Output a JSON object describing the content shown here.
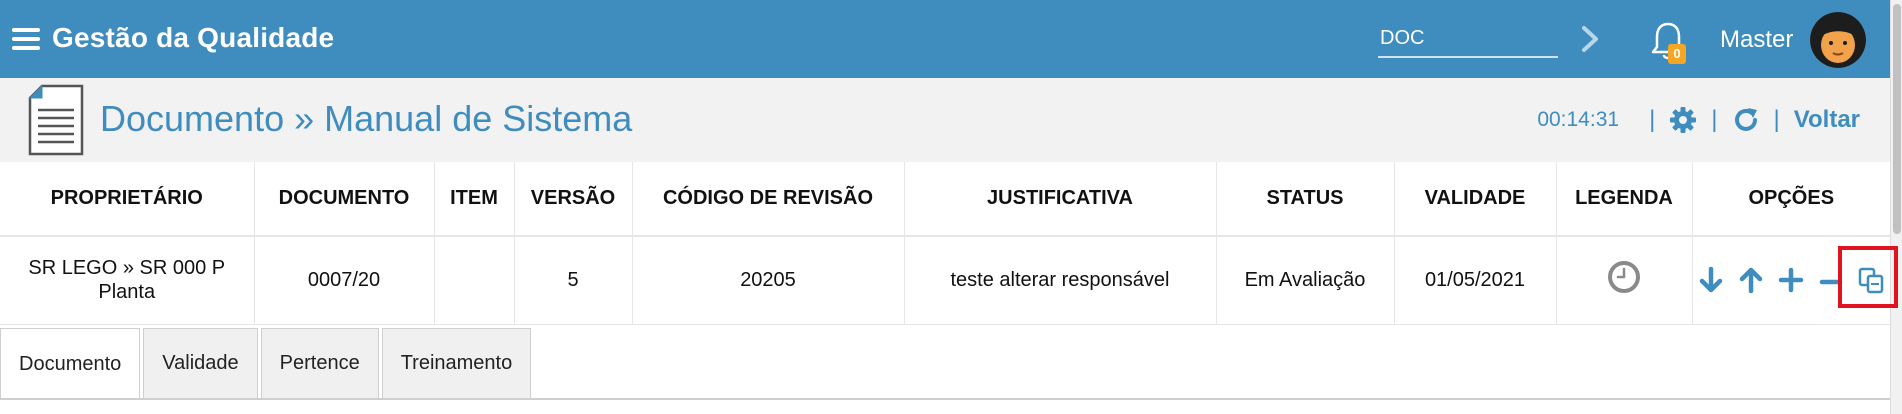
{
  "topbar": {
    "app_title": "Gestão da Qualidade",
    "search": {
      "value": "DOC",
      "placeholder": ""
    },
    "notifications_count": "0",
    "user_name": "Master",
    "bg_color": "#3f8dbf"
  },
  "header": {
    "title": "Documento » Manual de Sistema",
    "timer": "00:14:31",
    "back_label": "Voltar",
    "accent_color": "#3f8dbf"
  },
  "table": {
    "columns": [
      "PROPRIETÁRIO",
      "DOCUMENTO",
      "ITEM",
      "VERSÃO",
      "CÓDIGO DE REVISÃO",
      "JUSTIFICATIVA",
      "STATUS",
      "VALIDADE",
      "LEGENDA",
      "OPÇÕES"
    ],
    "row": {
      "proprietario": "SR LEGO » SR 000 P Planta",
      "documento": "0007/20",
      "item": "",
      "versao": "5",
      "codigo_revisao": "20205",
      "justificativa": "teste alterar responsável",
      "status": "Em Avaliação",
      "validade": "01/05/2021",
      "legenda_icon": "clock-icon",
      "opcoes_icons": [
        "arrow-down-icon",
        "arrow-up-icon",
        "plus-icon",
        "minus-icon",
        "copy-icon"
      ]
    }
  },
  "tabs": [
    {
      "label": "Documento",
      "active": true
    },
    {
      "label": "Validade",
      "active": false
    },
    {
      "label": "Pertence",
      "active": false
    },
    {
      "label": "Treinamento",
      "active": false
    }
  ],
  "highlight_color": "#e0141e"
}
